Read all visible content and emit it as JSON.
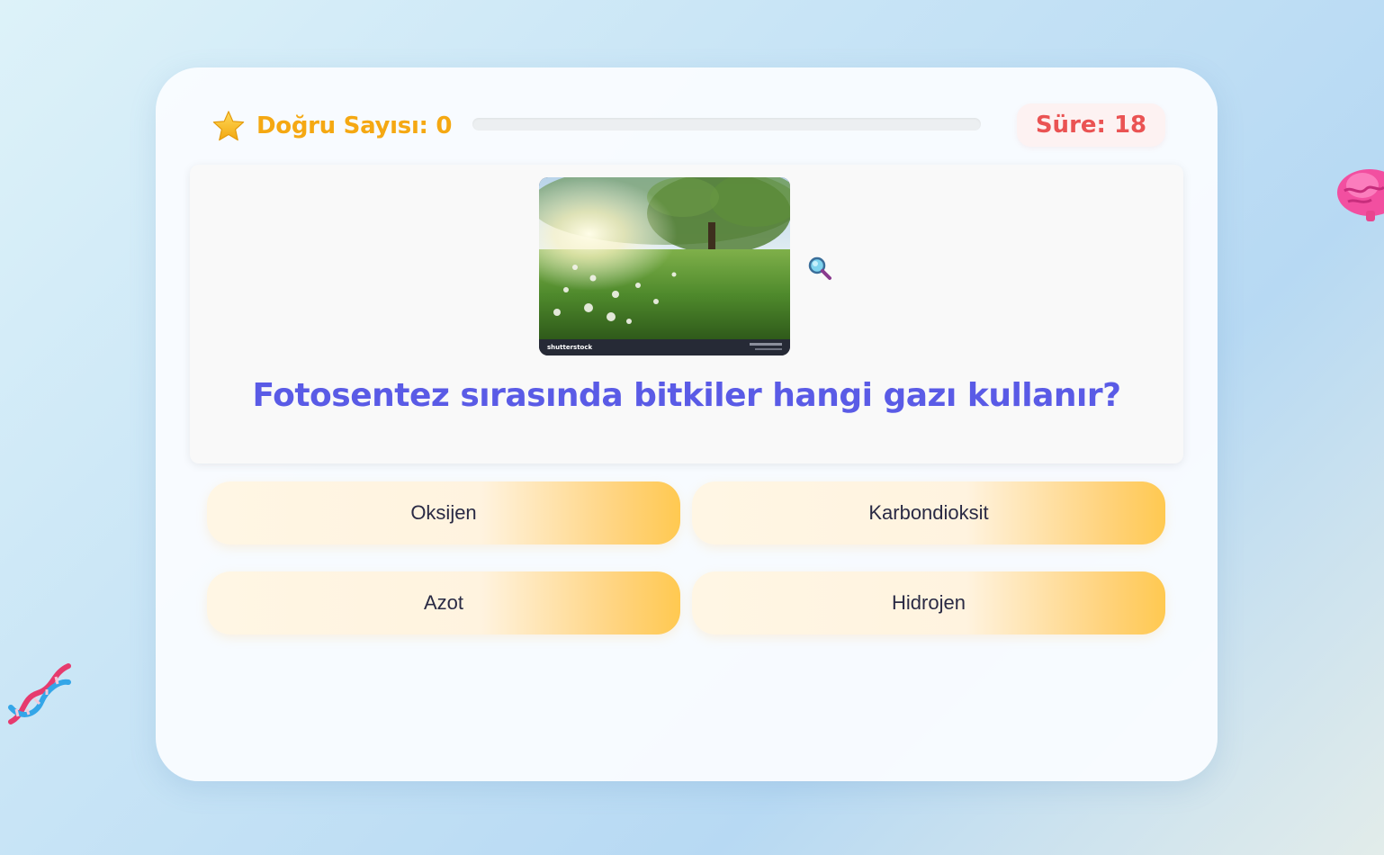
{
  "header": {
    "score_label": "Doğru Sayısı: 0",
    "timer_label": "Süre: 18",
    "progress_fraction": 0,
    "score_icon": "star-icon"
  },
  "question": {
    "text": "Fotosentez sırasında bitkiler hangi gazı kullanır?",
    "image_description_icon": "meadow-tree-photo",
    "image_watermark": "shutterstock",
    "zoom_icon": "magnifier-icon"
  },
  "answers": [
    {
      "label": "Oksijen"
    },
    {
      "label": "Karbondioksit"
    },
    {
      "label": "Azot"
    },
    {
      "label": "Hidrojen"
    }
  ],
  "decorations": {
    "left_icon": "dna-icon",
    "right_icon": "brain-icon"
  },
  "colors": {
    "score": "#f5a812",
    "timer": "#ea5353",
    "question": "#5a5be6",
    "answer_gradient_end": "#ffc951"
  }
}
